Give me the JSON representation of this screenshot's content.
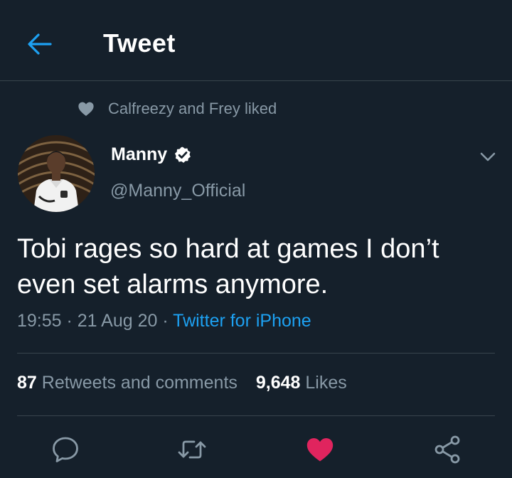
{
  "header": {
    "title": "Tweet",
    "back_icon": "arrow-left-icon"
  },
  "social_context": {
    "text": "Calfreezy and Frey liked"
  },
  "author": {
    "display_name": "Manny",
    "handle": "@Manny_Official",
    "verified": true
  },
  "tweet": {
    "text": "Tobi rages so hard at games I don’t even set alarms anymore.",
    "time": "19:55",
    "separator": " · ",
    "date": "21 Aug 20",
    "source": "Twitter for iPhone"
  },
  "stats": {
    "retweets_count": "87",
    "retweets_label": "Retweets and comments",
    "likes_count": "9,648",
    "likes_label": "Likes"
  },
  "actions": [
    "reply-icon",
    "retweet-icon",
    "like-icon",
    "share-icon"
  ],
  "colors": {
    "background": "#15202b",
    "accent": "#1da1f2",
    "secondary_text": "#8899a6",
    "divider": "#38444d",
    "like": "#e0245e"
  }
}
